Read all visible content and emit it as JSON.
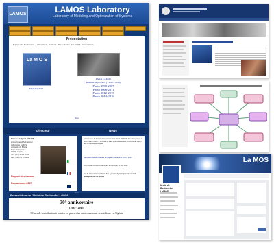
{
  "main": {
    "logo": "LAMOS",
    "title": "LAMOS Laboratory",
    "subtitle": "Laboratory of Modeling and Optimization of Systems",
    "presentation": {
      "heading": "Présentation",
      "links": "Equipes de Recherche · Le Directeur · Doctorat · Présentation du LAMOS · Informations",
      "lamos_logo": "La M O S",
      "diploma": "Diplomé 2017",
      "photos": [
        "Photos LAMOS",
        "Reunion de province (Y2005 - 2012)",
        "Photo 1998-2007",
        "Photo 2006-2011",
        "Photo 2012-2013",
        "Photo 2014-2016"
      ]
    },
    "next_label": "Next",
    "director_heading": "Directeur",
    "news_heading": "News",
    "director": {
      "name": "Professeur Djamil AÏSSANI",
      "lines": [
        "lamos_bejaia@hotmail.com",
        "Laboratoire LAMOS",
        "Université de Béjaïa",
        "Targa Ouzemmour",
        "06000 - Béjaïa",
        "Tél : (213) 34 21 08 00",
        "Fax : (213) 34 21 51 88"
      ],
      "report": "Rapport des travaux",
      "recruitment": "Recrutement 2017"
    },
    "news": {
      "text1": "Soutenance de l'habilitation universitaire de Dr. \"RAHIM Mourad\" prévue le jeudi 21 avril 2017 à 10h00 à la salle des conférences du centre de calcul de l'Université de Béjaïa",
      "text2": "Séminaire Mathématiques de Béjaïa Programme 2016 - 2017",
      "text3": "Le prochain séminaire aura lieu le mercredi 10 mai 2017",
      "text4": "Sur la découverte critique des sphères dynamiques \"ouverte\" — texte présenté Mr. Kadre"
    },
    "pres_heading": "Présentation de l'Unité de Recherche LaMOS",
    "anniv_title": "30° anniversaire",
    "anniv_years": "(1985 - 2015)",
    "anniv_caption": "30 ans de contribution à la mise en place d'un environnement scientifique en Algérie"
  },
  "shot1": {
    "title": "LaMOS",
    "subtitle": "Unité de Recherche LaMOS"
  },
  "shot2": {},
  "shot3": {
    "title": "La MOS",
    "page_name": "Unité de Recherche LaMOS"
  },
  "colors": {
    "navy": "#123a78",
    "gold": "#e3a62a",
    "blue_link": "#1a2fa0",
    "red": "#c01a1a"
  }
}
